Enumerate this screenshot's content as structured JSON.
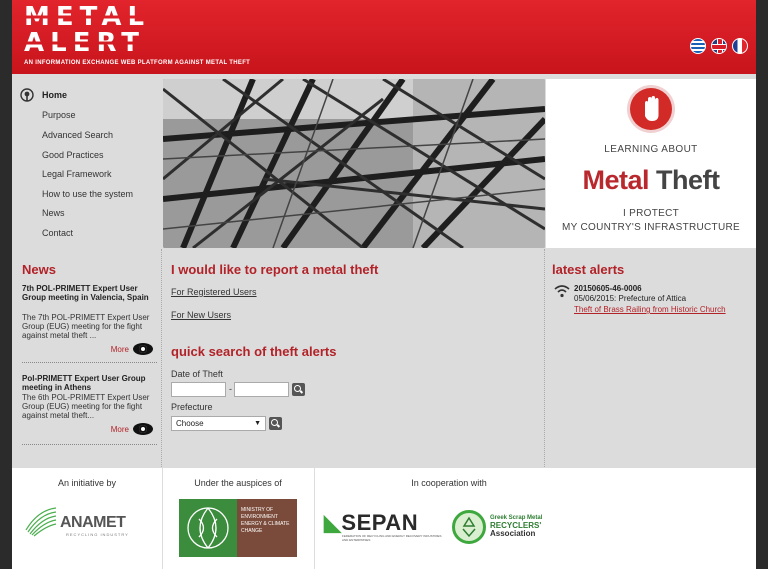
{
  "header": {
    "logo_line1": "METAL",
    "logo_line2": "ALERT",
    "tagline": "AN INFORMATION EXCHANGE WEB PLATFORM AGAINST METAL THEFT",
    "flags": [
      "greek-flag-icon",
      "uk-flag-icon",
      "french-flag-icon"
    ]
  },
  "nav": {
    "items": [
      {
        "label": "Home",
        "icon": "home-pin-icon"
      },
      {
        "label": "Purpose"
      },
      {
        "label": "Advanced Search"
      },
      {
        "label": "Good Practices"
      },
      {
        "label": "Legal Framework"
      },
      {
        "label": "How to use the system"
      },
      {
        "label": "News"
      },
      {
        "label": "Contact"
      }
    ]
  },
  "promo": {
    "learning": "LEARNING ABOUT",
    "title_metal": "Metal",
    "title_theft": "Theft",
    "protect_line1": "I PROTECT",
    "protect_line2": "MY COUNTRY'S INFRASTRUCTURE"
  },
  "news": {
    "title": "News",
    "items": [
      {
        "title": "7th POL-PRIMETT Expert User Group meeting in Valencia, Spain",
        "text": "The 7th POL-PRIMETT Expert User Group (EUG) meeting for the fight against metal theft ...",
        "more": "More"
      },
      {
        "title": "Pol-PRIMETT Expert User Group meeting in Athens",
        "text": "The 6th POL-PRIMETT Expert User Group (EUG) meeting for the fight against metal theft...",
        "more": "More"
      }
    ]
  },
  "report": {
    "title": "I would like to report a metal theft",
    "registered": "For Registered Users",
    "new_users": "For New Users"
  },
  "quick_search": {
    "title": "quick search of theft alerts",
    "date_label": "Date of Theft",
    "date_sep": "-",
    "prefecture_label": "Prefecture",
    "prefecture_value": "Choose"
  },
  "alerts": {
    "title": "latest alerts",
    "items": [
      {
        "id": "20150605-46-0006",
        "date_place": "05/06/2015: Prefecture of Attica",
        "link": "Theft of Brass Railing from Historic Church"
      }
    ]
  },
  "footer": {
    "initiative": "An initiative by",
    "auspices": "Under the auspices of",
    "cooperation": "In cooperation with",
    "anamet_name": "ANAMET",
    "anamet_sub": "RECYCLING INDUSTRY",
    "ministry_text": "MINISTRY OF ENVIRONMENT ENERGY & CLIMATE CHANGE",
    "sepan_name": "SEPAN",
    "sepan_sub": "FEDERATION OF RECYCLING AND ENERGY RECOVERY INDUSTRIES AND ENTERPRISES",
    "scrap_line1": "Greek Scrap Metal",
    "scrap_line2": "RECYCLERS'",
    "scrap_line3": "Association"
  },
  "colors": {
    "brand_red": "#d11d25",
    "link_red": "#b22228"
  }
}
